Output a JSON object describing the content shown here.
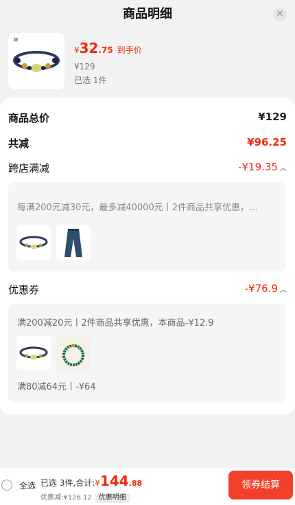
{
  "header": {
    "title": "商品明细",
    "close_icon": "close-icon"
  },
  "product": {
    "price_symbol": "¥",
    "price_int": "32",
    "price_dec": ".75",
    "price_tag": "到手价",
    "original_price": "¥129",
    "selected_count": "已选 1件"
  },
  "summary": {
    "total_label": "商品总价",
    "total_value": "¥129",
    "reduce_label": "共减",
    "reduce_value": "¥96.25"
  },
  "cross_store": {
    "label": "跨店满减",
    "value": "-¥19.35",
    "desc": "每满200元减30元，最多减40000元丨2件商品共享优惠，..."
  },
  "coupon": {
    "label": "优惠券",
    "value": "-¥76.9",
    "desc": "满200减20元丨2件商品共享优惠，本商品-¥12.9",
    "desc2": "满80减64元丨-¥64"
  },
  "bottom": {
    "select_all": "全选",
    "summary_prefix": "已选 3件,合计:",
    "total_symbol": "¥",
    "total_int": "144",
    "total_dec": ".88",
    "discount_text": "优惠减:¥126.12",
    "detail_label": "优惠明细",
    "checkout_label": "领券结算"
  },
  "colors": {
    "accent": "#f2270c",
    "button": "#f2402a"
  }
}
